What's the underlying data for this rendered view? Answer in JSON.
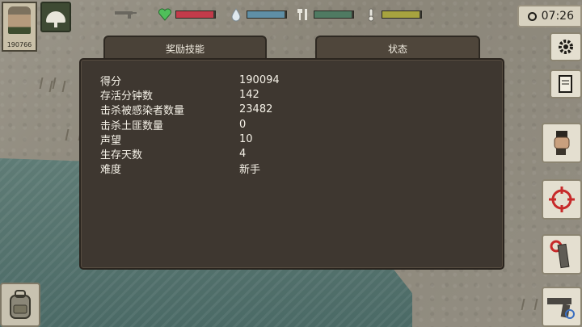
{
  "hud": {
    "player_id": "190766",
    "time": "07:26",
    "health_color": "#c23b4a",
    "water_color": "#5f8fa6",
    "food_color": "#4f7a62",
    "temp_color": "#a7a33f",
    "health_level": 0.95,
    "water_level": 0.95,
    "food_level": 0.95,
    "temp_level": 0.95
  },
  "tabs": [
    {
      "label": "奖励技能"
    },
    {
      "label": "状态"
    }
  ],
  "stats": [
    {
      "label": "得分",
      "value": "190094"
    },
    {
      "label": "存活分钟数",
      "value": "142"
    },
    {
      "label": "击杀被感染者数量",
      "value": "23482"
    },
    {
      "label": "击杀土匪数量",
      "value": "0"
    },
    {
      "label": "声望",
      "value": "10"
    },
    {
      "label": "生存天数",
      "value": "4"
    },
    {
      "label": "难度",
      "value": "新手"
    }
  ],
  "icons": {
    "weapon_slot": "gun-icon",
    "health": "heart-icon",
    "water": "water-drop-icon",
    "food": "fork-knife-icon",
    "temperature": "thermometer-icon",
    "settings": "gear-icon",
    "journal": "notebook-icon",
    "melee": "fist-icon",
    "target": "crosshair-icon",
    "ammo": "magazine-icon",
    "pistol": "pistol-icon",
    "backpack": "backpack-icon"
  }
}
